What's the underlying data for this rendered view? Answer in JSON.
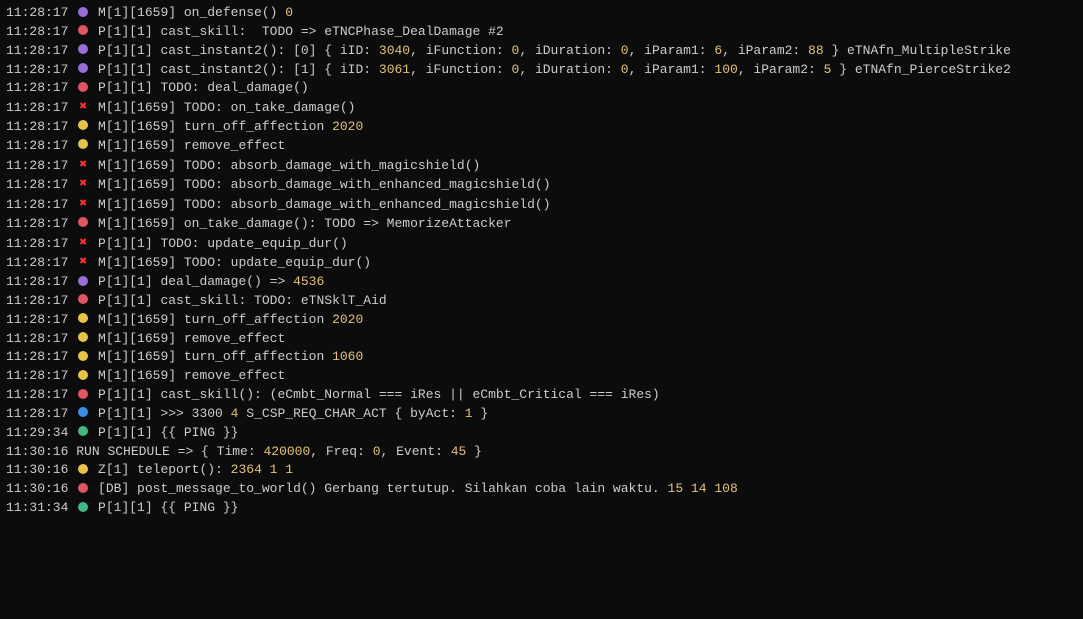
{
  "lines": [
    {
      "ts": "11:28:17",
      "marker": "purple",
      "segments": [
        {
          "t": "txt",
          "v": " M[1][1659] on_defense() "
        },
        {
          "t": "num",
          "v": "0"
        }
      ]
    },
    {
      "ts": "11:28:17",
      "marker": "red",
      "segments": [
        {
          "t": "txt",
          "v": " P[1][1] cast_skill:  TODO => eTNCPhase_DealDamage #2"
        }
      ]
    },
    {
      "ts": "11:28:17",
      "marker": "purple",
      "segments": [
        {
          "t": "txt",
          "v": " P[1][1] cast_instant2(): [0] { iID: "
        },
        {
          "t": "num",
          "v": "3040"
        },
        {
          "t": "txt",
          "v": ", iFunction: "
        },
        {
          "t": "num",
          "v": "0"
        },
        {
          "t": "txt",
          "v": ", iDuration: "
        },
        {
          "t": "num",
          "v": "0"
        },
        {
          "t": "txt",
          "v": ", iParam1: "
        },
        {
          "t": "num",
          "v": "6"
        },
        {
          "t": "txt",
          "v": ", iParam2: "
        },
        {
          "t": "num",
          "v": "88"
        },
        {
          "t": "txt",
          "v": " } eTNAfn_MultipleStrike"
        }
      ]
    },
    {
      "ts": "11:28:17",
      "marker": "purple",
      "segments": [
        {
          "t": "txt",
          "v": " P[1][1] cast_instant2(): [1] { iID: "
        },
        {
          "t": "num",
          "v": "3061"
        },
        {
          "t": "txt",
          "v": ", iFunction: "
        },
        {
          "t": "num",
          "v": "0"
        },
        {
          "t": "txt",
          "v": ", iDuration: "
        },
        {
          "t": "num",
          "v": "0"
        },
        {
          "t": "txt",
          "v": ", iParam1: "
        },
        {
          "t": "num",
          "v": "100"
        },
        {
          "t": "txt",
          "v": ", iParam2: "
        },
        {
          "t": "num",
          "v": "5"
        },
        {
          "t": "txt",
          "v": " } eTNAfn_PierceStrike2"
        }
      ]
    },
    {
      "ts": "11:28:17",
      "marker": "red",
      "segments": [
        {
          "t": "txt",
          "v": " P[1][1] TODO: deal_damage()"
        }
      ]
    },
    {
      "ts": "11:28:17",
      "marker": "cross",
      "segments": [
        {
          "t": "txt",
          "v": " M[1][1659] TODO: on_take_damage()"
        }
      ]
    },
    {
      "ts": "11:28:17",
      "marker": "yellow",
      "segments": [
        {
          "t": "txt",
          "v": " M[1][1659] turn_off_affection "
        },
        {
          "t": "num",
          "v": "2020"
        }
      ]
    },
    {
      "ts": "11:28:17",
      "marker": "yellow",
      "segments": [
        {
          "t": "txt",
          "v": " M[1][1659] remove_effect"
        }
      ]
    },
    {
      "ts": "11:28:17",
      "marker": "cross",
      "segments": [
        {
          "t": "txt",
          "v": " M[1][1659] TODO: absorb_damage_with_magicshield()"
        }
      ]
    },
    {
      "ts": "11:28:17",
      "marker": "cross",
      "segments": [
        {
          "t": "txt",
          "v": " M[1][1659] TODO: absorb_damage_with_enhanced_magicshield()"
        }
      ]
    },
    {
      "ts": "11:28:17",
      "marker": "cross",
      "segments": [
        {
          "t": "txt",
          "v": " M[1][1659] TODO: absorb_damage_with_enhanced_magicshield()"
        }
      ]
    },
    {
      "ts": "11:28:17",
      "marker": "red",
      "segments": [
        {
          "t": "txt",
          "v": " M[1][1659] on_take_damage(): TODO => MemorizeAttacker"
        }
      ]
    },
    {
      "ts": "11:28:17",
      "marker": "cross",
      "segments": [
        {
          "t": "txt",
          "v": " P[1][1] TODO: update_equip_dur()"
        }
      ]
    },
    {
      "ts": "11:28:17",
      "marker": "cross",
      "segments": [
        {
          "t": "txt",
          "v": " M[1][1659] TODO: update_equip_dur()"
        }
      ]
    },
    {
      "ts": "11:28:17",
      "marker": "purple",
      "segments": [
        {
          "t": "txt",
          "v": " P[1][1] deal_damage() => "
        },
        {
          "t": "num",
          "v": "4536"
        }
      ]
    },
    {
      "ts": "11:28:17",
      "marker": "red",
      "segments": [
        {
          "t": "txt",
          "v": " P[1][1] cast_skill: TODO: eTNSklT_Aid"
        }
      ]
    },
    {
      "ts": "11:28:17",
      "marker": "yellow",
      "segments": [
        {
          "t": "txt",
          "v": " M[1][1659] turn_off_affection "
        },
        {
          "t": "num",
          "v": "2020"
        }
      ]
    },
    {
      "ts": "11:28:17",
      "marker": "yellow",
      "segments": [
        {
          "t": "txt",
          "v": " M[1][1659] remove_effect"
        }
      ]
    },
    {
      "ts": "11:28:17",
      "marker": "yellow",
      "segments": [
        {
          "t": "txt",
          "v": " M[1][1659] turn_off_affection "
        },
        {
          "t": "num",
          "v": "1060"
        }
      ]
    },
    {
      "ts": "11:28:17",
      "marker": "yellow",
      "segments": [
        {
          "t": "txt",
          "v": " M[1][1659] remove_effect"
        }
      ]
    },
    {
      "ts": "11:28:17",
      "marker": "red",
      "segments": [
        {
          "t": "txt",
          "v": " P[1][1] cast_skill(): (eCmbt_Normal === iRes || eCmbt_Critical === iRes)"
        }
      ]
    },
    {
      "ts": "11:28:17",
      "marker": "blue",
      "segments": [
        {
          "t": "txt",
          "v": " P[1][1] >>> 3300 "
        },
        {
          "t": "num",
          "v": "4"
        },
        {
          "t": "txt",
          "v": " S_CSP_REQ_CHAR_ACT { byAct: "
        },
        {
          "t": "num",
          "v": "1"
        },
        {
          "t": "txt",
          "v": " }"
        }
      ]
    },
    {
      "ts": "11:29:34",
      "marker": "green",
      "segments": [
        {
          "t": "txt",
          "v": " P[1][1] {{ PING }}"
        }
      ]
    },
    {
      "ts": "11:30:16",
      "marker": "none",
      "segments": [
        {
          "t": "txt",
          "v": "RUN SCHEDULE => { Time: "
        },
        {
          "t": "num",
          "v": "420000"
        },
        {
          "t": "txt",
          "v": ", Freq: "
        },
        {
          "t": "num",
          "v": "0"
        },
        {
          "t": "txt",
          "v": ", Event: "
        },
        {
          "t": "num",
          "v": "45"
        },
        {
          "t": "txt",
          "v": " }"
        }
      ]
    },
    {
      "ts": "11:30:16",
      "marker": "yellow",
      "segments": [
        {
          "t": "txt",
          "v": " Z[1] teleport(): "
        },
        {
          "t": "num",
          "v": "2364 1 1"
        }
      ]
    },
    {
      "ts": "11:30:16",
      "marker": "red",
      "segments": [
        {
          "t": "txt",
          "v": " [DB] post_message_to_world() Gerbang tertutup. Silahkan coba lain waktu. "
        },
        {
          "t": "num",
          "v": "15 14 108"
        }
      ]
    },
    {
      "ts": "11:31:34",
      "marker": "green",
      "segments": [
        {
          "t": "txt",
          "v": " P[1][1] {{ PING }}"
        }
      ]
    }
  ]
}
